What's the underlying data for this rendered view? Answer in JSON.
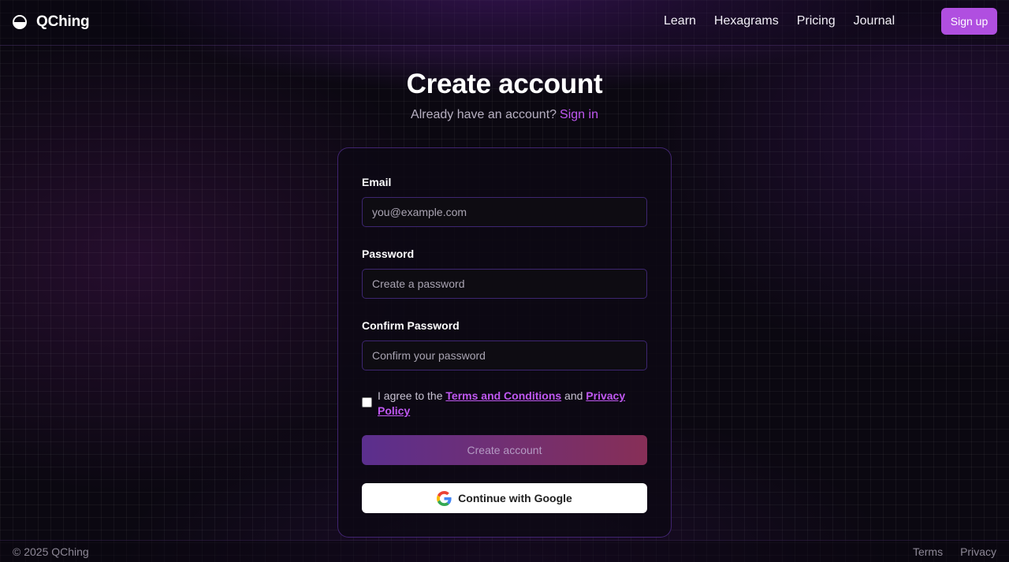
{
  "brand": {
    "name": "QChing"
  },
  "nav": [
    {
      "label": "Learn"
    },
    {
      "label": "Hexagrams"
    },
    {
      "label": "Pricing"
    },
    {
      "label": "Journal"
    }
  ],
  "header": {
    "signup_label": "Sign up"
  },
  "page": {
    "title": "Create account",
    "subtitle_prefix": "Already have an account?",
    "signin_label": "Sign in"
  },
  "form": {
    "email": {
      "label": "Email",
      "placeholder": "you@example.com",
      "value": ""
    },
    "password": {
      "label": "Password",
      "placeholder": "Create a password",
      "value": ""
    },
    "confirm": {
      "label": "Confirm Password",
      "placeholder": "Confirm your password",
      "value": ""
    },
    "agree": {
      "prefix": "I agree to the",
      "terms_label": "Terms and Conditions",
      "and_label": "and",
      "privacy_label": "Privacy Policy",
      "checked": false
    },
    "create_label": "Create account",
    "google_label": "Continue with Google"
  },
  "footer": {
    "copyright": "© 2025 QChing",
    "links": [
      {
        "label": "Terms"
      },
      {
        "label": "Privacy"
      }
    ]
  },
  "colors": {
    "accent": "#b04fe0",
    "link": "#c058f2",
    "background": "#0b0811"
  },
  "icons": {
    "brand": "yin-yang-icon",
    "google": "google-logo-icon"
  }
}
